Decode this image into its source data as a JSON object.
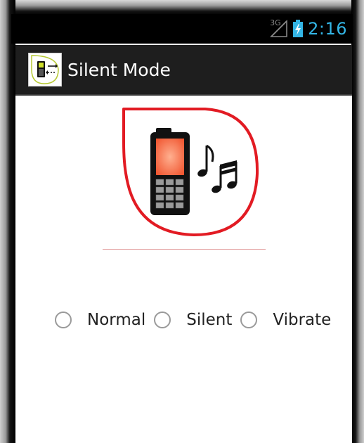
{
  "status_bar": {
    "network_type": "3G",
    "time": "2:16",
    "icons": [
      "signal-icon",
      "battery-charging-icon"
    ],
    "time_color": "#33b5e5"
  },
  "action_bar": {
    "title": "Silent Mode",
    "icon": "phone-sound-mode-icon",
    "background": "#1e1e1e"
  },
  "main": {
    "hero_icon": "phone-with-music-notes-icon",
    "accent_color": "#e21b23",
    "radio_options": [
      {
        "label": "Normal",
        "selected": false
      },
      {
        "label": "Silent",
        "selected": false
      },
      {
        "label": "Vibrate",
        "selected": false
      }
    ]
  }
}
